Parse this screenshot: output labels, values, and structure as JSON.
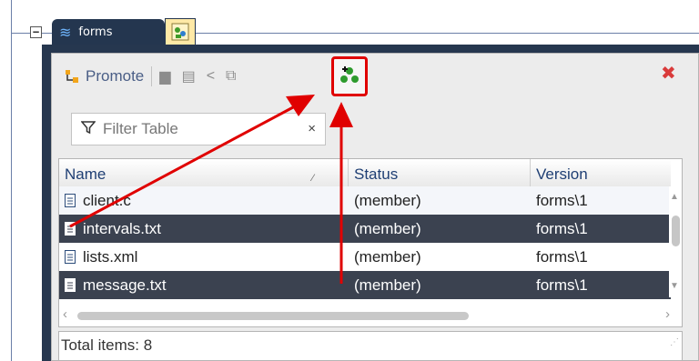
{
  "tree": {
    "node_label": "forms",
    "expander": "−"
  },
  "toolbar": {
    "promote_label": "Promote",
    "icons": [
      "promote-icon",
      "document-icon",
      "copy-icon",
      "branch-icon",
      "export-icon",
      "add-members-icon"
    ]
  },
  "filter": {
    "placeholder": "Filter Table",
    "clear": "×"
  },
  "table": {
    "columns": [
      "Name",
      "Status",
      "Version"
    ],
    "rows": [
      {
        "name": "client.c",
        "status": "(member)",
        "version": "forms\\1",
        "selected": false
      },
      {
        "name": "intervals.txt",
        "status": "(member)",
        "version": "forms\\1",
        "selected": true
      },
      {
        "name": "lists.xml",
        "status": "(member)",
        "version": "forms\\1",
        "selected": false
      },
      {
        "name": "message.txt",
        "status": "(member)",
        "version": "forms\\1",
        "selected": true
      }
    ]
  },
  "footer": {
    "total_label": "Total items: 8"
  },
  "colors": {
    "accent_red": "#e00000",
    "panel_dark": "#26374f",
    "selected_row": "#3b4250"
  }
}
